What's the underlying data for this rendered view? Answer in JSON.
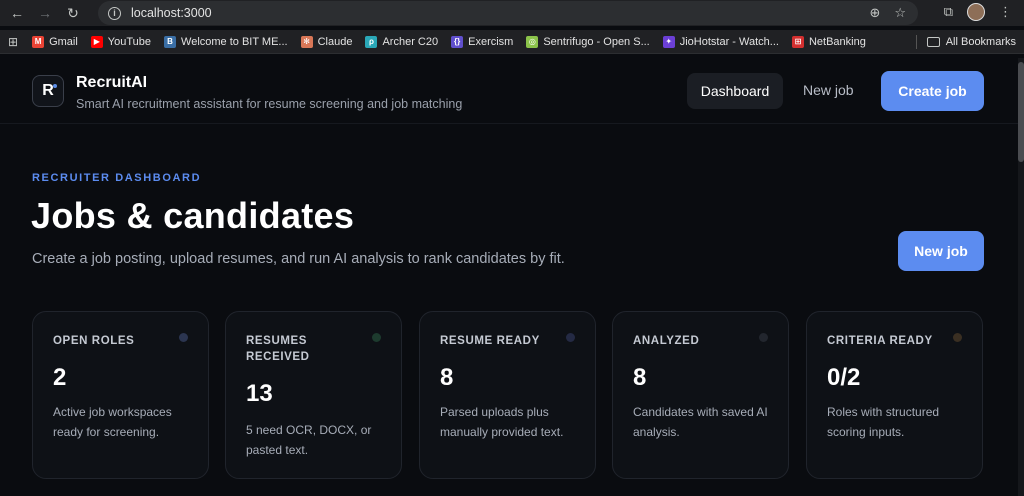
{
  "browser": {
    "url": "localhost:3000",
    "bookmarks": [
      {
        "label": "Gmail",
        "icon": "gmail-icon",
        "color": "#ea4335",
        "glyph": "M"
      },
      {
        "label": "YouTube",
        "icon": "youtube-icon",
        "color": "#ff0000",
        "glyph": "▶"
      },
      {
        "label": "Welcome to BIT ME...",
        "icon": "bit-icon",
        "color": "#3a6ea5",
        "glyph": "B"
      },
      {
        "label": "Claude",
        "icon": "claude-icon",
        "color": "#d97757",
        "glyph": "✻"
      },
      {
        "label": "Archer C20",
        "icon": "archer-icon",
        "color": "#2aa8b8",
        "glyph": "ρ"
      },
      {
        "label": "Exercism",
        "icon": "exercism-icon",
        "color": "#604fcd",
        "glyph": "{}"
      },
      {
        "label": "Sentrifugo - Open S...",
        "icon": "sentrifugo-icon",
        "color": "#8bc34a",
        "glyph": "◎"
      },
      {
        "label": "JioHotstar - Watch...",
        "icon": "jiohotstar-icon",
        "color": "#6b3fd6",
        "glyph": "✦"
      },
      {
        "label": "NetBanking",
        "icon": "netbanking-icon",
        "color": "#d32f2f",
        "glyph": "⊞"
      }
    ],
    "all_bookmarks": "All Bookmarks"
  },
  "header": {
    "logo_letter": "R",
    "brand": "RecruitAI",
    "tagline": "Smart AI recruitment assistant for resume screening and job matching",
    "nav_dashboard": "Dashboard",
    "nav_new_job": "New job",
    "create_job": "Create job"
  },
  "main": {
    "eyebrow": "RECRUITER DASHBOARD",
    "title": "Jobs & candidates",
    "subtitle": "Create a job posting, upload resumes, and run AI analysis to rank candidates by fit.",
    "new_job": "New job"
  },
  "stats": [
    {
      "label": "OPEN ROLES",
      "value": "2",
      "desc": "Active job workspaces ready for screening.",
      "dot": "#2b3550"
    },
    {
      "label": "RESUMES RECEIVED",
      "value": "13",
      "desc": "5 need OCR, DOCX, or pasted text.",
      "dot": "#1d3b2e"
    },
    {
      "label": "RESUME READY",
      "value": "8",
      "desc": "Parsed uploads plus manually provided text.",
      "dot": "#242a44"
    },
    {
      "label": "ANALYZED",
      "value": "8",
      "desc": "Candidates with saved AI analysis.",
      "dot": "#22262e"
    },
    {
      "label": "CRITERIA READY",
      "value": "0/2",
      "desc": "Roles with structured scoring inputs.",
      "dot": "#3a2f22"
    }
  ]
}
